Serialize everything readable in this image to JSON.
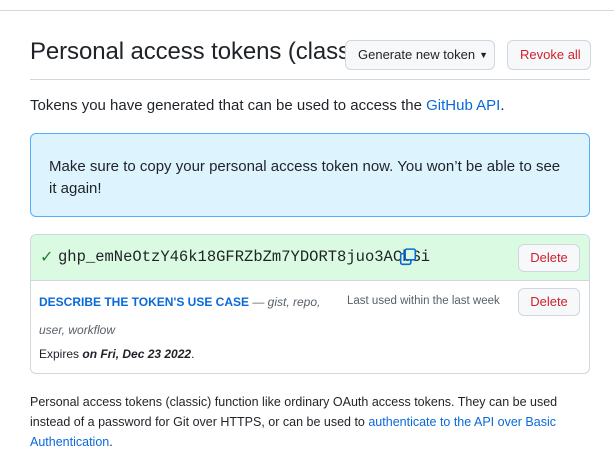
{
  "header": {
    "title": "Personal access tokens (classic)",
    "generate_label": "Generate new token",
    "revoke_label": "Revoke all"
  },
  "intro": {
    "text": "Tokens you have generated that can be used to access the ",
    "link": "GitHub API",
    "suffix": "."
  },
  "flash": {
    "message": "Make sure to copy your personal access token now. You won’t be able to see it again!"
  },
  "token": {
    "value": "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",
    "delete_label": "Delete",
    "use_case_label": "DESCRIBE THE TOKEN'S USE CASE",
    "scopes_line1": " — gist, repo,",
    "scopes_line2": "user, workflow",
    "last_used": "Last used within the last week",
    "delete_label_2": "Delete",
    "expires_prefix": "Expires ",
    "expires_date": "on Fri, Dec 23 2022",
    "expires_suffix": "."
  },
  "footnote": {
    "text": "Personal access tokens (classic) function like ordinary OAuth access tokens. They can be used instead of a password for Git over HTTPS, or can be used to ",
    "link": "authenticate to the API over Basic Authentication",
    "suffix": "."
  },
  "colors": {
    "accent_link": "#0969da",
    "danger": "#cf222e",
    "success": "#1a7f37",
    "flash_bg": "#ddf4ff",
    "token_bg": "#dafbe1"
  }
}
